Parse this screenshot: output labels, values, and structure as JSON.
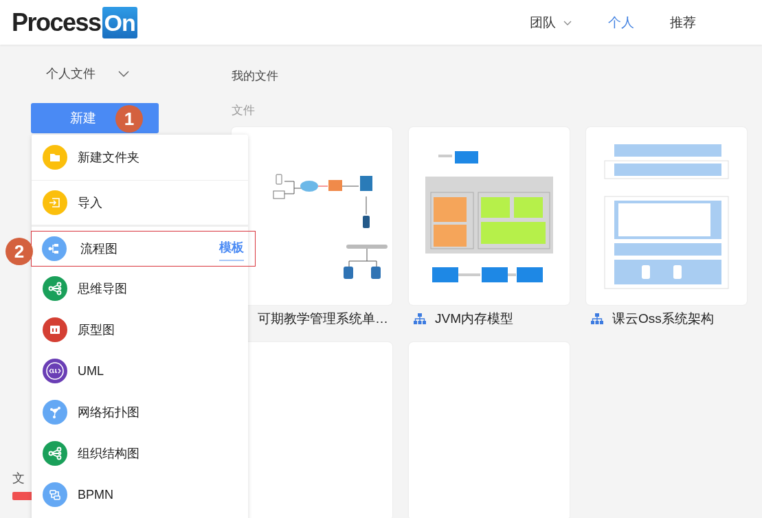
{
  "logo": {
    "text": "Process",
    "badge": "On"
  },
  "nav": [
    {
      "label": "团队",
      "dropdown": true,
      "selected": false
    },
    {
      "label": "个人",
      "dropdown": false,
      "selected": true
    },
    {
      "label": "推荐",
      "dropdown": false,
      "selected": false
    }
  ],
  "sidebar": {
    "section": "个人文件",
    "new_button": "新建",
    "step_badge": "1",
    "footer_label": "文"
  },
  "new_menu": {
    "items": [
      {
        "label": "新建文件夹",
        "kind": "folder",
        "color": "#fbbf0c",
        "selected": false
      },
      {
        "label": "导入",
        "kind": "import",
        "color": "#fbbf0c",
        "selected": false
      },
      {
        "label": "流程图",
        "kind": "flowchart",
        "color": "#64a8f4",
        "selected": true,
        "step_badge": "2",
        "template_link": "模板"
      },
      {
        "label": "思维导图",
        "kind": "mindmap",
        "color": "#1aa05a",
        "selected": false
      },
      {
        "label": "原型图",
        "kind": "prototype",
        "color": "#d43f33",
        "selected": false
      },
      {
        "label": "UML",
        "kind": "uml",
        "color": "#6a3eb5",
        "selected": false
      },
      {
        "label": "网络拓扑图",
        "kind": "network",
        "color": "#64a8f4",
        "selected": false
      },
      {
        "label": "组织结构图",
        "kind": "org",
        "color": "#1aa05a",
        "selected": false
      },
      {
        "label": "BPMN",
        "kind": "bpmn",
        "color": "#64a8f4",
        "selected": false
      }
    ]
  },
  "main": {
    "title": "我的文件",
    "section": "文件",
    "files": [
      {
        "title": "可期教学管理系统单…",
        "kind": "deployment",
        "icon": false
      },
      {
        "title": "JVM内存模型",
        "kind": "jvm",
        "icon": true
      },
      {
        "title": "课云Oss系统架构",
        "kind": "architecture",
        "icon": true
      },
      {
        "kind": "blank"
      },
      {
        "kind": "blank"
      }
    ]
  }
}
